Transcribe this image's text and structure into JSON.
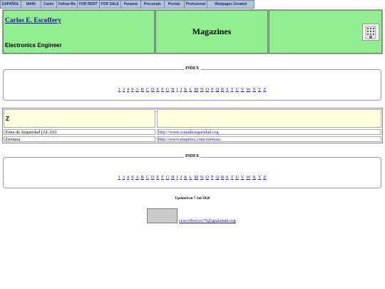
{
  "nav": {
    "items": [
      "ESPAÑOL",
      "MAIN",
      "Cards",
      "Follow Me",
      "FOR RENT",
      "FOR SALE",
      "Panamá",
      "Personals",
      "Portals",
      "Profesional",
      "Webpages Created"
    ]
  },
  "header": {
    "author_name": "Carlos E. Escoffery",
    "author_title": "Electronics Engineer",
    "page_title": "Magazines"
  },
  "index": {
    "legend": "INDEX",
    "letters": [
      "1",
      "3",
      "4",
      "9",
      "A",
      "B",
      "C",
      "D",
      "E",
      "F",
      "G",
      "H",
      "I",
      "J",
      "K",
      "L",
      "M",
      "N",
      "O",
      "P",
      "Q",
      "R",
      "S",
      "T",
      "U",
      "V",
      "W",
      "X",
      "Y",
      "Z"
    ]
  },
  "section": {
    "letter": "Z",
    "rows": [
      {
        "name": "Zona de Seguridad (ALAS)",
        "url": "http://www.zonadeseguridad.org"
      },
      {
        "name": "Zootaxa",
        "url": "http://www.mapress.com/zootaxa"
      }
    ]
  },
  "footer": {
    "updated": "Updated on 7-Jul-2020",
    "email": "cescoffery.ee76@gtalumni.org"
  },
  "colors": {
    "nav_bg": "#b0c4de",
    "header_bg": "#90ee90",
    "section_bg": "#ffffe0",
    "link": "#1a0dab"
  }
}
